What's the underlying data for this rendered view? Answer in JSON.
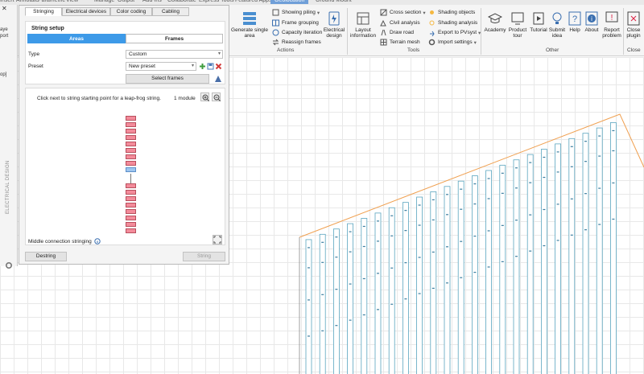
{
  "menubar": {
    "items": [
      "Insert",
      "Annotate",
      "Parametric",
      "View",
      "Manage",
      "Output",
      "Add-ins",
      "Collaborate",
      "Express Tools",
      "Featured Apps",
      "Geolocation",
      "Ground Mount"
    ],
    "active_index": 10
  },
  "ribbon": {
    "generate_single_area": "Generate single area",
    "showing_piling": "Showing piling",
    "frame_grouping": "Frame grouping",
    "capacity_iteration": "Capacity iteration",
    "reassign_frames": "Reassign frames",
    "electrical_design": "Electrical design",
    "actions_label": "Actions",
    "layout_information": "Layout information",
    "cross_section": "Cross section",
    "civil_analysis": "Civil analysis",
    "draw_road": "Draw road",
    "terrain_mesh": "Terrain mesh",
    "shading_objects": "Shading objects",
    "shading_analysis": "Shading analysis",
    "export_to_pvsyst": "Export to PVsyst",
    "import_settings": "Import settings",
    "tools_label": "Tools",
    "academy": "Academy",
    "product_tour": "Product tour",
    "tutorial": "Tutorial",
    "submit_idea": "Submit idea",
    "help": "Help",
    "about": "About",
    "report_problem": "Report problem",
    "other_label": "Other",
    "close_plugin": "Close plugin",
    "close_label": "Close"
  },
  "leftstrip": {
    "label": "ELECTRICAL DESIGN",
    "snippet_a": "aye",
    "snippet_b": "port",
    "snippet_c": "op]"
  },
  "panel": {
    "tabs": [
      "Stringing",
      "Electrical devices",
      "Color coding",
      "Cabling"
    ],
    "active_tab": 0,
    "setup_title": "String setup",
    "segment": {
      "areas": "Areas",
      "frames": "Frames",
      "active": "areas"
    },
    "type_label": "Type",
    "type_value": "Custom",
    "preset_label": "Preset",
    "preset_value": "New preset",
    "select_frames": "Select frames",
    "instruction": "Click next to string starting point for a leap-frog string.",
    "module_count": "1 module",
    "middle_connection": "Middle connection stringing",
    "destring": "Destring",
    "string": "String"
  },
  "colors": {
    "accent": "#3d9ae8",
    "module_fill": "#f38b9a",
    "module_selected": "#9ec5ef",
    "boundary": "#f0a050",
    "frame_stroke": "#5aa5bf"
  },
  "string_preview": {
    "upper_modules": 8,
    "lower_modules": 8,
    "selected_modules": 1
  }
}
